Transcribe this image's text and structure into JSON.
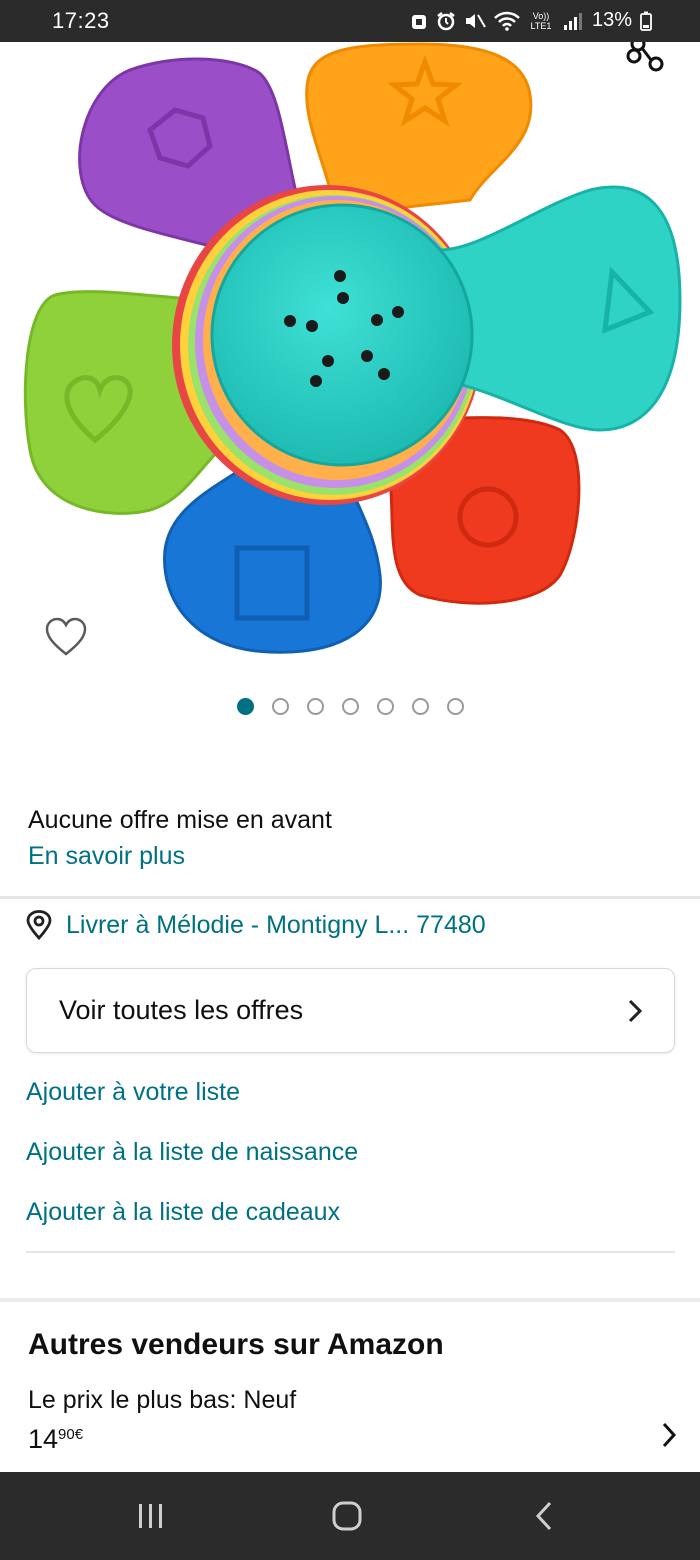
{
  "status": {
    "time": "17:23",
    "signal_label": "Vo)) LTE1",
    "battery": "13%"
  },
  "product": {
    "image_alt": "Stacking shape sorter toy flower",
    "carousel_pages": 7,
    "carousel_active": 1
  },
  "offer": {
    "no_offer": "Aucune offre mise en avant",
    "learn_more": "En savoir plus"
  },
  "delivery": {
    "text": "Livrer à Mélodie - Montigny L... 77480"
  },
  "offers_button": {
    "label": "Voir toutes les offres"
  },
  "lists": {
    "add_list": "Ajouter à votre liste",
    "add_birth_list": "Ajouter à la liste de naissance",
    "add_gift_list": "Ajouter à la liste de cadeaux"
  },
  "sellers": {
    "title": "Autres vendeurs sur Amazon",
    "lowest_label": "Le prix le plus bas: Neuf",
    "price_whole": "14",
    "price_fraction": "90",
    "currency": "€"
  },
  "colors": {
    "link": "#007185",
    "text": "#0f1111",
    "statusbar": "#2b2b2b"
  }
}
